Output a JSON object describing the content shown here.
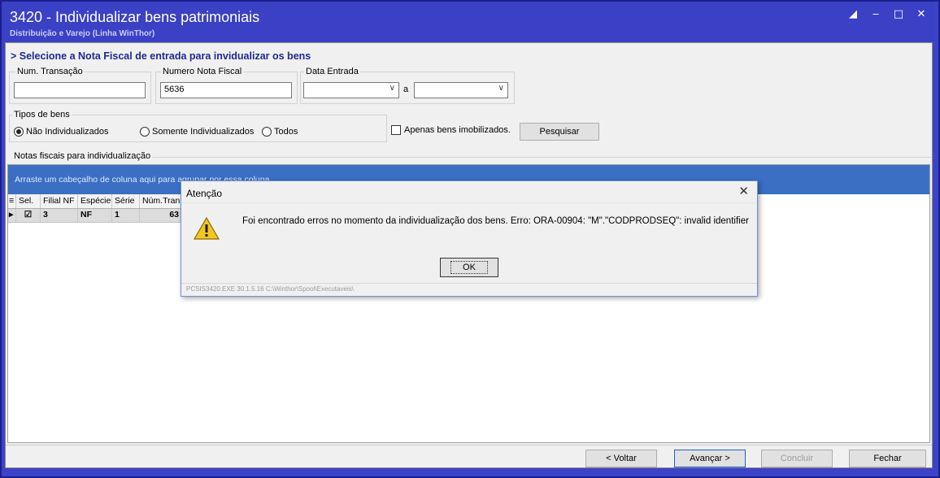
{
  "window": {
    "title": "3420 - Individualizar bens patrimoniais",
    "subtitle": "Distribuição e Varejo (Linha WinThor)",
    "buttons": [
      "restore",
      "minimize",
      "maximize",
      "close"
    ]
  },
  "header": {
    "heading": "> Selecione a Nota Fiscal de entrada para invidualizar os bens"
  },
  "filters": {
    "num_transacao": {
      "label": "Num. Transação",
      "value": ""
    },
    "numero_nota": {
      "label": "Numero Nota Fiscal",
      "value": "5636"
    },
    "data_entrada": {
      "label": "Data Entrada",
      "from": "",
      "separator": "a",
      "to": ""
    }
  },
  "tipos_bens": {
    "label": "Tipos de bens",
    "options": [
      {
        "label": "Não Individualizados",
        "selected": true
      },
      {
        "label": "Somente Individualizados",
        "selected": false
      },
      {
        "label": "Todos",
        "selected": false
      }
    ]
  },
  "apenas_imobilizados": {
    "label": "Apenas bens imobilizados.",
    "checked": false
  },
  "pesquisar_label": "Pesquisar",
  "section_label": "Notas fiscais para individualização",
  "grid": {
    "group_hint": "Arraste um cabeçalho de coluna aqui para agrupar por essa coluna",
    "columns": [
      "",
      "Sel.",
      "Filial NF",
      "Espécie",
      "Série",
      "Núm.Tran"
    ],
    "rows": [
      {
        "selected": true,
        "filial": "3",
        "especie": "NF",
        "serie": "1",
        "num_tran": "63"
      }
    ]
  },
  "dialog": {
    "title": "Atenção",
    "message": "Foi encontrado erros no momento da individualização dos bens. Erro: ORA-00904: \"M\".\"CODPRODSEQ\": invalid identifier",
    "ok_label": "OK",
    "footer": "PCSIS3420.EXE 30.1.5.16 C:\\Winthor\\Spool\\Executaveis\\"
  },
  "footer_buttons": {
    "voltar": "< Voltar",
    "avancar": "Avançar >",
    "concluir": "Concluir",
    "fechar": "Fechar"
  },
  "colors": {
    "titlebar": "#3b41c5",
    "heading": "#1f2a8f",
    "groupbar": "#3a6fc4"
  }
}
